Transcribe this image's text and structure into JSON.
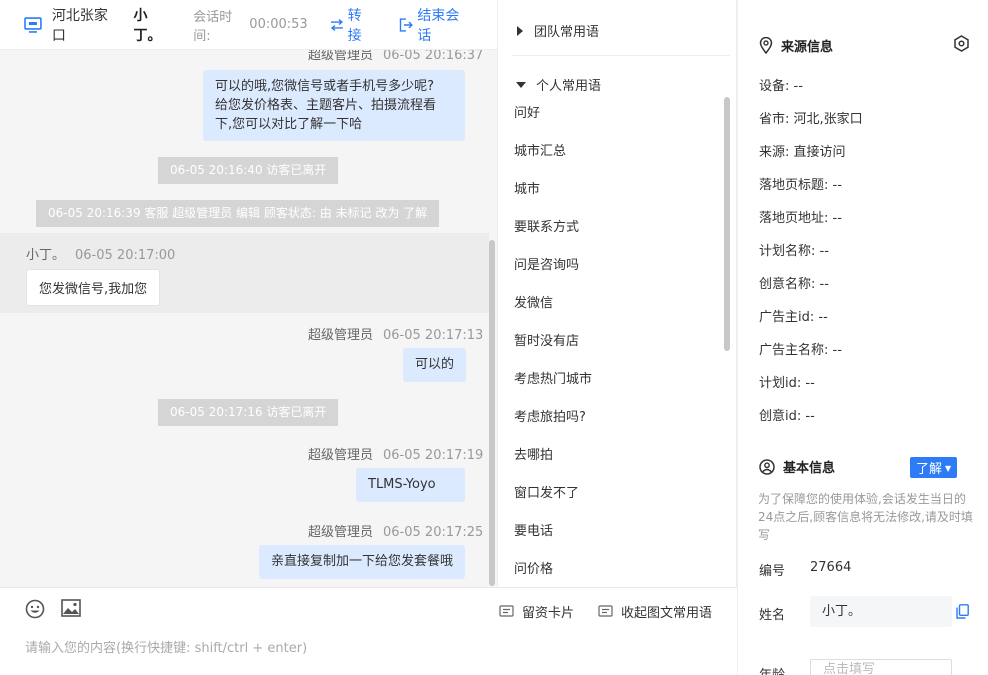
{
  "header": {
    "location": "河北张家口",
    "visitor_name": "小丁。",
    "session_time_label": "会话时间:",
    "session_time_value": "00:00:53",
    "transfer_label": "转接",
    "end_label": "结束会话"
  },
  "chat": {
    "msg1_sender": "超级管理员",
    "msg1_time": "06-05 20:16:37",
    "msg1_line1": "可以的哦,您微信号或者手机号多少呢?",
    "msg1_line2": "给您发价格表、主题客片、拍摄流程看",
    "msg1_line3": "下,您可以对比了解一下哈",
    "sys1": "06-05 20:16:40 访客已离开",
    "sys2": "06-05 20:16:39 客服 超级管理员 编辑 顾客状态: 由 未标记 改为 了解",
    "msg2_sender": "小丁。",
    "msg2_time": "06-05 20:17:00",
    "msg2_text": "您发微信号,我加您",
    "msg3_sender": "超级管理员",
    "msg3_time": "06-05 20:17:13",
    "msg3_text": "可以的",
    "sys3": "06-05 20:17:16 访客已离开",
    "msg4_sender": "超级管理员",
    "msg4_time": "06-05 20:17:19",
    "msg4_text": "TLMS-Yoyo",
    "msg5_sender": "超级管理员",
    "msg5_time": "06-05 20:17:25",
    "msg5_text": "亲直接复制加一下给您发套餐哦"
  },
  "composer": {
    "card_label": "留资卡片",
    "collapse_label": "收起图文常用语",
    "placeholder": "请输入您的内容(换行快捷键: shift/ctrl + enter)"
  },
  "phrases": {
    "team_group": "团队常用语",
    "personal_group": "个人常用语",
    "items": [
      "问好",
      "城市汇总",
      "城市",
      "要联系方式",
      "问是咨询吗",
      "发微信",
      "暂时没有店",
      "考虑热门城市",
      "考虑旅拍吗?",
      "去哪拍",
      "窗口发不了",
      "要电话",
      "问价格"
    ]
  },
  "info": {
    "source_title": "来源信息",
    "rows": [
      {
        "k": "设备:",
        "v": "--"
      },
      {
        "k": "省市:",
        "v": "河北,张家口"
      },
      {
        "k": "来源:",
        "v": "直接访问"
      },
      {
        "k": "落地页标题:",
        "v": "--"
      },
      {
        "k": "落地页地址:",
        "v": "--"
      },
      {
        "k": "计划名称:",
        "v": "--"
      },
      {
        "k": "创意名称:",
        "v": "--"
      },
      {
        "k": "广告主id:",
        "v": "--"
      },
      {
        "k": "广告主名称:",
        "v": "--"
      },
      {
        "k": "计划id:",
        "v": "--"
      },
      {
        "k": "创意id:",
        "v": "--"
      }
    ],
    "basic_title": "基本信息",
    "status_value": "了解",
    "note": "为了保障您的使用体验,会话发生当日的24点之后,顾客信息将无法修改,请及时填写",
    "id_label": "编号",
    "id_value": "27664",
    "name_label": "姓名",
    "name_value": "小丁。",
    "age_label": "年龄",
    "age_placeholder": "点击填写"
  },
  "colors": {
    "accent": "#2d7cf6",
    "bubble_out": "#dceaff",
    "system_bar": "#d5d5d5"
  }
}
